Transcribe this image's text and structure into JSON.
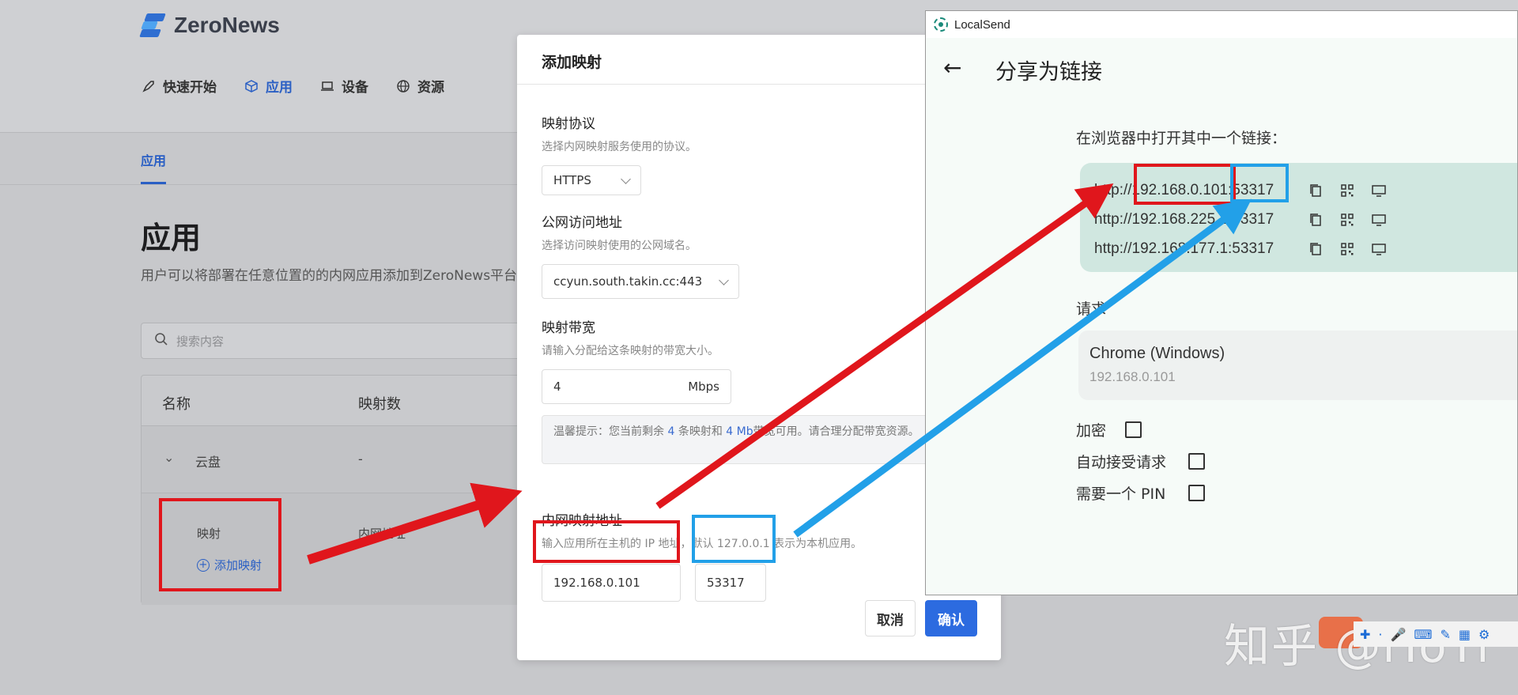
{
  "zeronews": {
    "brand": "ZeroNews",
    "nav": [
      {
        "label": "快速开始",
        "icon": "rocket-icon"
      },
      {
        "label": "应用",
        "icon": "cube-icon"
      },
      {
        "label": "设备",
        "icon": "laptop-icon"
      },
      {
        "label": "资源",
        "icon": "globe-icon"
      }
    ],
    "subtab": "应用",
    "page_title": "应用",
    "page_desc": "用户可以将部署在任意位置的的内网应用添加到ZeroNews平台",
    "search_placeholder": "搜索内容",
    "table": {
      "headers": [
        "名称",
        "映射数"
      ],
      "rows": [
        {
          "name": "云盘",
          "count": "-"
        }
      ],
      "sub_label": "映射",
      "sub_add": "添加映射",
      "sub_inner": "内网地址"
    }
  },
  "dialog": {
    "title": "添加映射",
    "protocol": {
      "label": "映射协议",
      "help": "选择内网映射服务使用的协议。",
      "value": "HTTPS"
    },
    "domain": {
      "label": "公网访问地址",
      "help": "选择访问映射使用的公网域名。",
      "value": "ccyun.south.takin.cc:443"
    },
    "bandwidth": {
      "label": "映射带宽",
      "help": "请输入分配给这条映射的带宽大小。",
      "value": "4",
      "unit": "Mbps"
    },
    "tip": {
      "prefix": "温馨提示：您当前剩余",
      "maps": "4",
      "mid": "条映射和",
      "bw": "4 Mb",
      "suffix": "带宽可用。请合理分配带宽资源。"
    },
    "address": {
      "label": "内网映射地址",
      "help": "输入应用所在主机的 IP 地址，默认 127.0.0.1 表示为本机应用。",
      "ip": "192.168.0.101",
      "port": "53317"
    },
    "cancel": "取消",
    "confirm": "确认"
  },
  "localsend": {
    "window_title": "LocalSend",
    "page_title": "分享为链接",
    "hint": "在浏览器中打开其中一个链接：",
    "links": [
      "http://192.168.0.101:53317",
      "http://192.168.225.1:53317",
      "http://192.168.177.1:53317"
    ],
    "request_title": "请求",
    "request_client": "Chrome (Windows)",
    "request_ip": "192.168.0.101",
    "options": [
      {
        "label": "加密",
        "checked": false
      },
      {
        "label": "自动接受请求",
        "checked": false
      },
      {
        "label": "需要一个 PIN",
        "checked": false
      }
    ]
  },
  "watermark": "知乎 @iToTi",
  "colors": {
    "annotation_red": "#e0161c",
    "annotation_blue": "#22a0e8",
    "primary_blue": "#2c6be0"
  }
}
